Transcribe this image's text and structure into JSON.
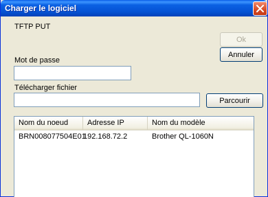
{
  "window": {
    "title": "Charger le logiciel"
  },
  "form": {
    "protocol_label": "TFTP PUT",
    "password_label": "Mot de passe",
    "password_value": "",
    "upload_label": "Télécharger fichier",
    "upload_value": ""
  },
  "buttons": {
    "ok": "Ok",
    "cancel": "Annuler",
    "browse": "Parcourir"
  },
  "device_list": {
    "columns": [
      "Nom du noeud",
      "Adresse IP",
      "Nom du modèle"
    ],
    "rows": [
      {
        "node_name": "BRN008077504E01",
        "ip_address": "192.168.72.2",
        "model_name": "Brother QL-1060N"
      }
    ]
  }
}
